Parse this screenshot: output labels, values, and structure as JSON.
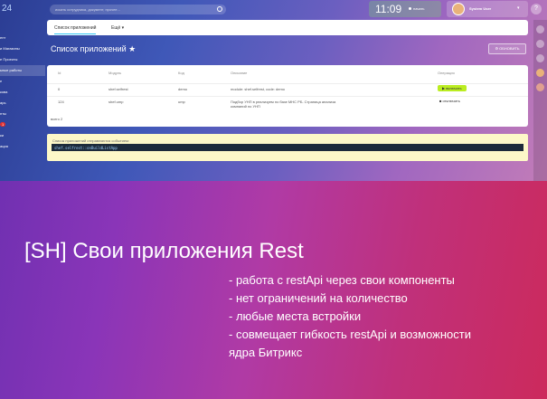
{
  "topbar": {
    "logo_suffix": "24",
    "search_placeholder": "искать сотрудника, документ, прочее...",
    "clock": "11:09",
    "start_label": "начать",
    "user_name": "System User"
  },
  "leftnav": {
    "items": [
      {
        "label": "ент"
      },
      {
        "label": "и Магазины"
      },
      {
        "label": "е Проекты"
      },
      {
        "label": "ьные работы"
      },
      {
        "label": "е"
      },
      {
        "label": "кова"
      },
      {
        "label": "арь"
      },
      {
        "label": "нты"
      },
      {
        "label": "ки"
      },
      {
        "label": "ация"
      }
    ],
    "badge": "1"
  },
  "tabs": {
    "main": "Список приложений",
    "more": "Ещё"
  },
  "page": {
    "title": "Список приложений ★",
    "refresh": "ОБНОВИТЬ"
  },
  "grid": {
    "headers": [
      "Id",
      "Модуль",
      "Код",
      "Описание",
      "Операция"
    ],
    "rows": [
      {
        "id": "0",
        "module": "shef.selfrest",
        "code": "demo",
        "desc": "module: shef.selfrest, code: demo",
        "action": "▶ включить"
      },
      {
        "id": "124",
        "module": "shef.ump",
        "code": "ump",
        "desc": "Подбор УНП в реализуем по базе МНС РБ. Страница анализа компаний по УНП",
        "action": "■ отключить"
      }
    ],
    "total": "всего 2"
  },
  "event": {
    "text": "Список приложений отправляются событием:",
    "code": "shef.selfrest::onBuildListApp"
  },
  "banner": {
    "title": "[SH] Свои приложения Rest",
    "features": [
      "- работа с restApi через свои компоненты",
      "- нет ограничений на количество",
      "- любые места встройки",
      "- совмещает гибкость restApi и возможности",
      "ядра Битрикс"
    ]
  },
  "colors": {
    "accent_blue": "#2fc6f6",
    "enable_green": "#bbed21",
    "gradient_start": "#6a2fb0",
    "gradient_end": "#cc2a5c"
  }
}
